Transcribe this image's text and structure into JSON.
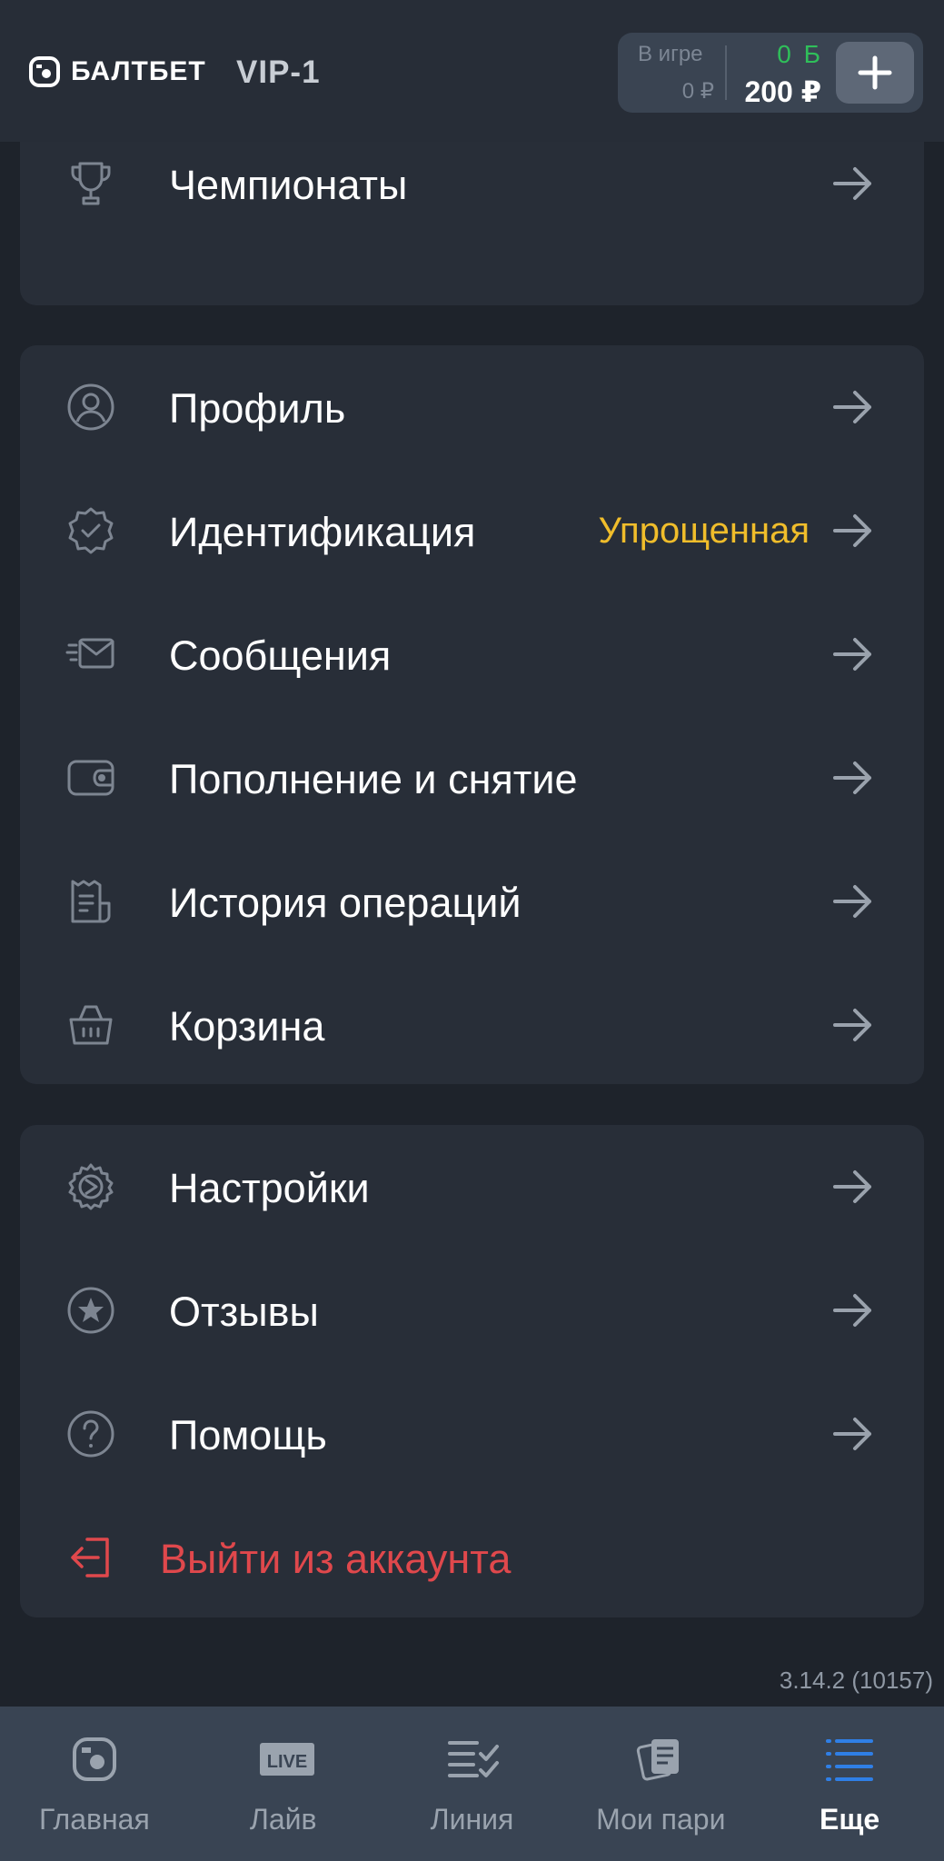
{
  "header": {
    "logo_text": "БАЛТБЕТ",
    "vip_level": "VIP-1",
    "balance": {
      "in_game_label": "В игре",
      "in_game_value": "0 ₽",
      "bonus": "0 Б",
      "money": "200 ₽"
    }
  },
  "sections": {
    "top": {
      "championships": "Чемпионаты"
    },
    "account": {
      "profile": "Профиль",
      "identification": "Идентификация",
      "identification_status": "Упрощенная",
      "messages": "Сообщения",
      "deposit_withdraw": "Пополнение и снятие",
      "history": "История операций",
      "cart": "Корзина"
    },
    "misc": {
      "settings": "Настройки",
      "reviews": "Отзывы",
      "help": "Помощь",
      "logout": "Выйти из аккаунта"
    }
  },
  "version": "3.14.2 (10157)",
  "tabbar": {
    "home": "Главная",
    "live": "Лайв",
    "live_badge": "LIVE",
    "line": "Линия",
    "my_bets": "Мои пари",
    "more": "Еще"
  },
  "colors": {
    "background": "#1e232b",
    "card": "#282e38",
    "accent_yellow": "#f0bd2b",
    "logout_red": "#e0484c",
    "bonus_green": "#2fbf5a",
    "active_tab_blue": "#2f7fe6"
  }
}
